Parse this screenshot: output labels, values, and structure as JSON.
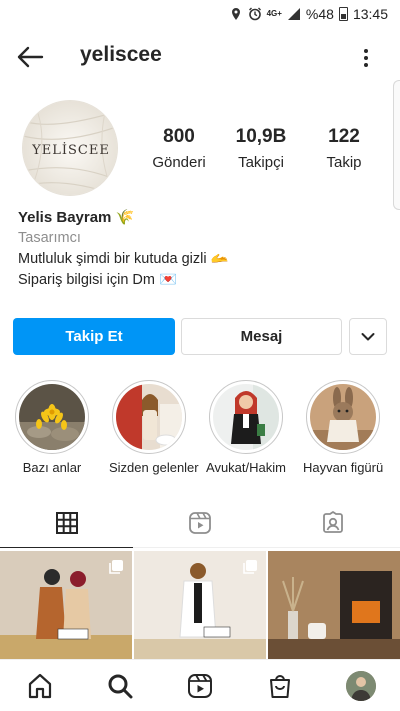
{
  "status_bar": {
    "network": "4G+",
    "battery": "%48",
    "time": "13:45"
  },
  "header": {
    "username": "yeliscee"
  },
  "profile": {
    "avatar_logo_text": "YELİSCEE",
    "stats": [
      {
        "value": "800",
        "label": "Gönderi"
      },
      {
        "value": "10,9B",
        "label": "Takipçi"
      },
      {
        "value": "122",
        "label": "Takip"
      }
    ],
    "name": "Yelis Bayram 🌾",
    "category": "Tasarımcı",
    "bio_lines": [
      "Mutluluk şimdi bir kutuda gizli 🫴",
      "Sipariş bilgisi için Dm 💌"
    ]
  },
  "actions": {
    "follow_label": "Takip Et",
    "message_label": "Mesaj"
  },
  "highlights": [
    {
      "label": "Bazı anlar"
    },
    {
      "label": "Sizden gelenler"
    },
    {
      "label": "Avukat/Hakim"
    },
    {
      "label": "Hayvan figürü"
    }
  ],
  "colors": {
    "accent": "#0095f6",
    "text": "#262626",
    "secondary_text": "#8e8e8e",
    "border": "#dbdbdb"
  }
}
